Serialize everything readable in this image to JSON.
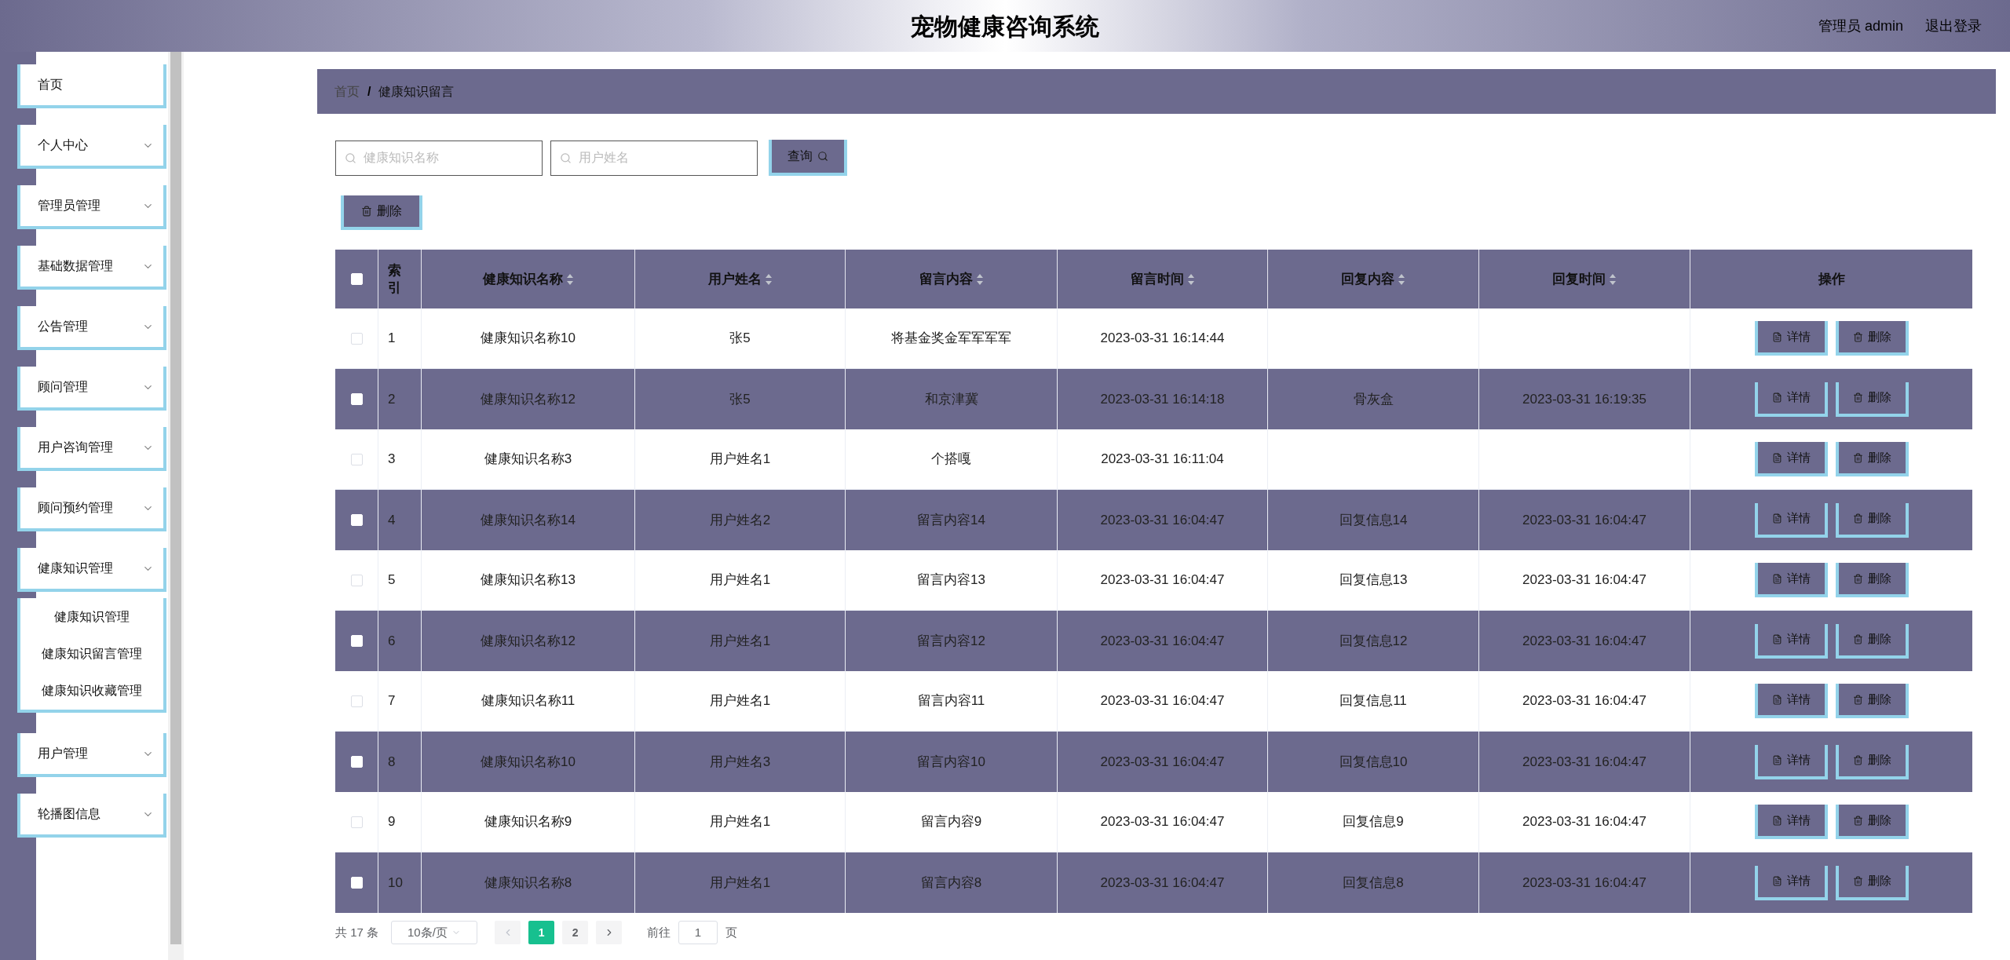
{
  "header": {
    "title": "宠物健康咨询系统",
    "user": "管理员 admin",
    "logout": "退出登录"
  },
  "sidebar": {
    "items": [
      {
        "label": "首页",
        "expandable": false
      },
      {
        "label": "个人中心",
        "expandable": true
      },
      {
        "label": "管理员管理",
        "expandable": true
      },
      {
        "label": "基础数据管理",
        "expandable": true
      },
      {
        "label": "公告管理",
        "expandable": true
      },
      {
        "label": "顾问管理",
        "expandable": true
      },
      {
        "label": "用户咨询管理",
        "expandable": true
      },
      {
        "label": "顾问预约管理",
        "expandable": true
      },
      {
        "label": "健康知识管理",
        "expandable": true,
        "children": [
          {
            "label": "健康知识管理"
          },
          {
            "label": "健康知识留言管理"
          },
          {
            "label": "健康知识收藏管理"
          }
        ]
      },
      {
        "label": "用户管理",
        "expandable": true
      },
      {
        "label": "轮播图信息",
        "expandable": true
      }
    ]
  },
  "breadcrumb": {
    "items": [
      "首页",
      "健康知识留言"
    ],
    "separator": "/"
  },
  "search": {
    "fields": [
      {
        "placeholder": "健康知识名称"
      },
      {
        "placeholder": "用户姓名"
      }
    ],
    "button": "查询"
  },
  "delete_button": "删除",
  "table": {
    "columns": [
      {
        "label": "索引",
        "sortable": false
      },
      {
        "label": "健康知识名称",
        "sortable": true
      },
      {
        "label": "用户姓名",
        "sortable": true
      },
      {
        "label": "留言内容",
        "sortable": true
      },
      {
        "label": "留言时间",
        "sortable": true
      },
      {
        "label": "回复内容",
        "sortable": true
      },
      {
        "label": "回复时间",
        "sortable": true
      },
      {
        "label": "操作",
        "sortable": false
      }
    ],
    "select_all": false,
    "rows": [
      {
        "checked": false,
        "cells": [
          "1",
          "健康知识名称10",
          "张5",
          "将基金奖金军军军军",
          "2023-03-31 16:14:44",
          "",
          ""
        ],
        "actions": [
          {
            "kind": "details",
            "label": "详情"
          },
          {
            "kind": "delete",
            "label": "删除"
          }
        ]
      },
      {
        "checked": false,
        "cells": [
          "2",
          "健康知识名称12",
          "张5",
          "和京津冀",
          "2023-03-31 16:14:18",
          "骨灰盒",
          "2023-03-31 16:19:35"
        ],
        "actions": [
          {
            "kind": "details",
            "label": "详情"
          },
          {
            "kind": "delete",
            "label": "删除"
          }
        ]
      },
      {
        "checked": false,
        "cells": [
          "3",
          "健康知识名称3",
          "用户姓名1",
          "个搭嘎",
          "2023-03-31 16:11:04",
          "",
          ""
        ],
        "actions": [
          {
            "kind": "details",
            "label": "详情"
          },
          {
            "kind": "delete",
            "label": "删除"
          }
        ]
      },
      {
        "checked": false,
        "cells": [
          "4",
          "健康知识名称14",
          "用户姓名2",
          "留言内容14",
          "2023-03-31 16:04:47",
          "回复信息14",
          "2023-03-31 16:04:47"
        ],
        "actions": [
          {
            "kind": "details",
            "label": "详情"
          },
          {
            "kind": "delete",
            "label": "删除"
          }
        ]
      },
      {
        "checked": false,
        "cells": [
          "5",
          "健康知识名称13",
          "用户姓名1",
          "留言内容13",
          "2023-03-31 16:04:47",
          "回复信息13",
          "2023-03-31 16:04:47"
        ],
        "actions": [
          {
            "kind": "details",
            "label": "详情"
          },
          {
            "kind": "delete",
            "label": "删除"
          }
        ]
      },
      {
        "checked": false,
        "cells": [
          "6",
          "健康知识名称12",
          "用户姓名1",
          "留言内容12",
          "2023-03-31 16:04:47",
          "回复信息12",
          "2023-03-31 16:04:47"
        ],
        "actions": [
          {
            "kind": "details",
            "label": "详情"
          },
          {
            "kind": "delete",
            "label": "删除"
          }
        ]
      },
      {
        "checked": false,
        "cells": [
          "7",
          "健康知识名称11",
          "用户姓名1",
          "留言内容11",
          "2023-03-31 16:04:47",
          "回复信息11",
          "2023-03-31 16:04:47"
        ],
        "actions": [
          {
            "kind": "details",
            "label": "详情"
          },
          {
            "kind": "delete",
            "label": "删除"
          }
        ]
      },
      {
        "checked": false,
        "cells": [
          "8",
          "健康知识名称10",
          "用户姓名3",
          "留言内容10",
          "2023-03-31 16:04:47",
          "回复信息10",
          "2023-03-31 16:04:47"
        ],
        "actions": [
          {
            "kind": "details",
            "label": "详情"
          },
          {
            "kind": "delete",
            "label": "删除"
          }
        ]
      },
      {
        "checked": false,
        "cells": [
          "9",
          "健康知识名称9",
          "用户姓名1",
          "留言内容9",
          "2023-03-31 16:04:47",
          "回复信息9",
          "2023-03-31 16:04:47"
        ],
        "actions": [
          {
            "kind": "details",
            "label": "详情"
          },
          {
            "kind": "delete",
            "label": "删除"
          }
        ]
      },
      {
        "checked": false,
        "cells": [
          "10",
          "健康知识名称8",
          "用户姓名1",
          "留言内容8",
          "2023-03-31 16:04:47",
          "回复信息8",
          "2023-03-31 16:04:47"
        ],
        "actions": [
          {
            "kind": "details",
            "label": "详情"
          },
          {
            "kind": "delete",
            "label": "删除"
          }
        ]
      }
    ]
  },
  "pagination": {
    "total": "共 17 条",
    "page_size": "10条/页",
    "pages": [
      {
        "label": "1",
        "selected": true
      },
      {
        "label": "2",
        "selected": false
      }
    ],
    "goto_label": "前往",
    "goto_value": "1",
    "goto_suffix": "页"
  }
}
